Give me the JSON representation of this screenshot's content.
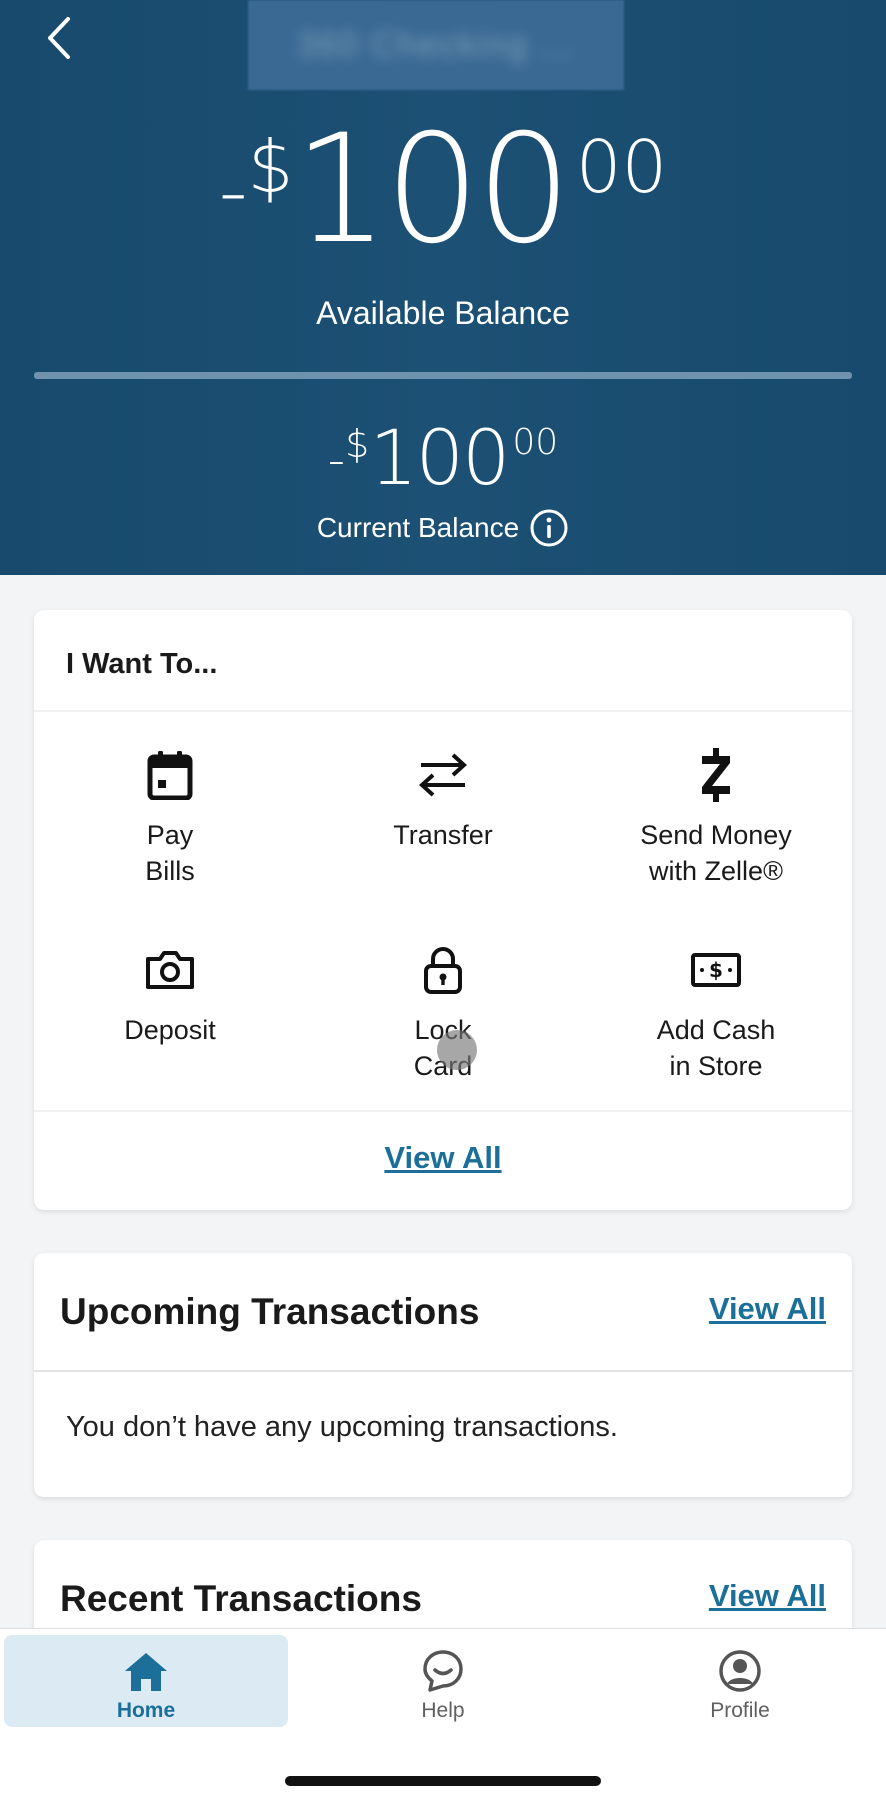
{
  "header": {
    "account_name": "360 Checking ...",
    "available_balance": {
      "sign": "-",
      "currency": "$",
      "dollars": "100",
      "cents": "00",
      "label": "Available Balance"
    },
    "current_balance": {
      "sign": "-",
      "currency": "$",
      "dollars": "100",
      "cents": "00",
      "label": "Current Balance"
    }
  },
  "want_to": {
    "title": "I Want To...",
    "actions": [
      {
        "label": "Pay\nBills",
        "icon": "calendar-icon"
      },
      {
        "label": "Transfer",
        "icon": "transfer-arrows-icon"
      },
      {
        "label": "Send Money\nwith Zelle®",
        "icon": "zelle-icon"
      },
      {
        "label": "Deposit",
        "icon": "camera-icon"
      },
      {
        "label": "Lock\nCard",
        "icon": "lock-icon"
      },
      {
        "label": "Add Cash\nin Store",
        "icon": "cash-icon"
      }
    ],
    "view_all": "View All"
  },
  "upcoming": {
    "title": "Upcoming Transactions",
    "view_all": "View All",
    "empty_message": "You don’t have any upcoming transactions."
  },
  "recent": {
    "title": "Recent Transactions",
    "view_all": "View All"
  },
  "nav": {
    "items": [
      {
        "label": "Home",
        "icon": "home-icon",
        "active": true
      },
      {
        "label": "Help",
        "icon": "chat-bubble-icon",
        "active": false
      },
      {
        "label": "Profile",
        "icon": "profile-icon",
        "active": false
      }
    ]
  },
  "colors": {
    "header_bg": "#1c5074",
    "accent": "#1b6f99",
    "active_nav_bg": "#dceaf3"
  }
}
